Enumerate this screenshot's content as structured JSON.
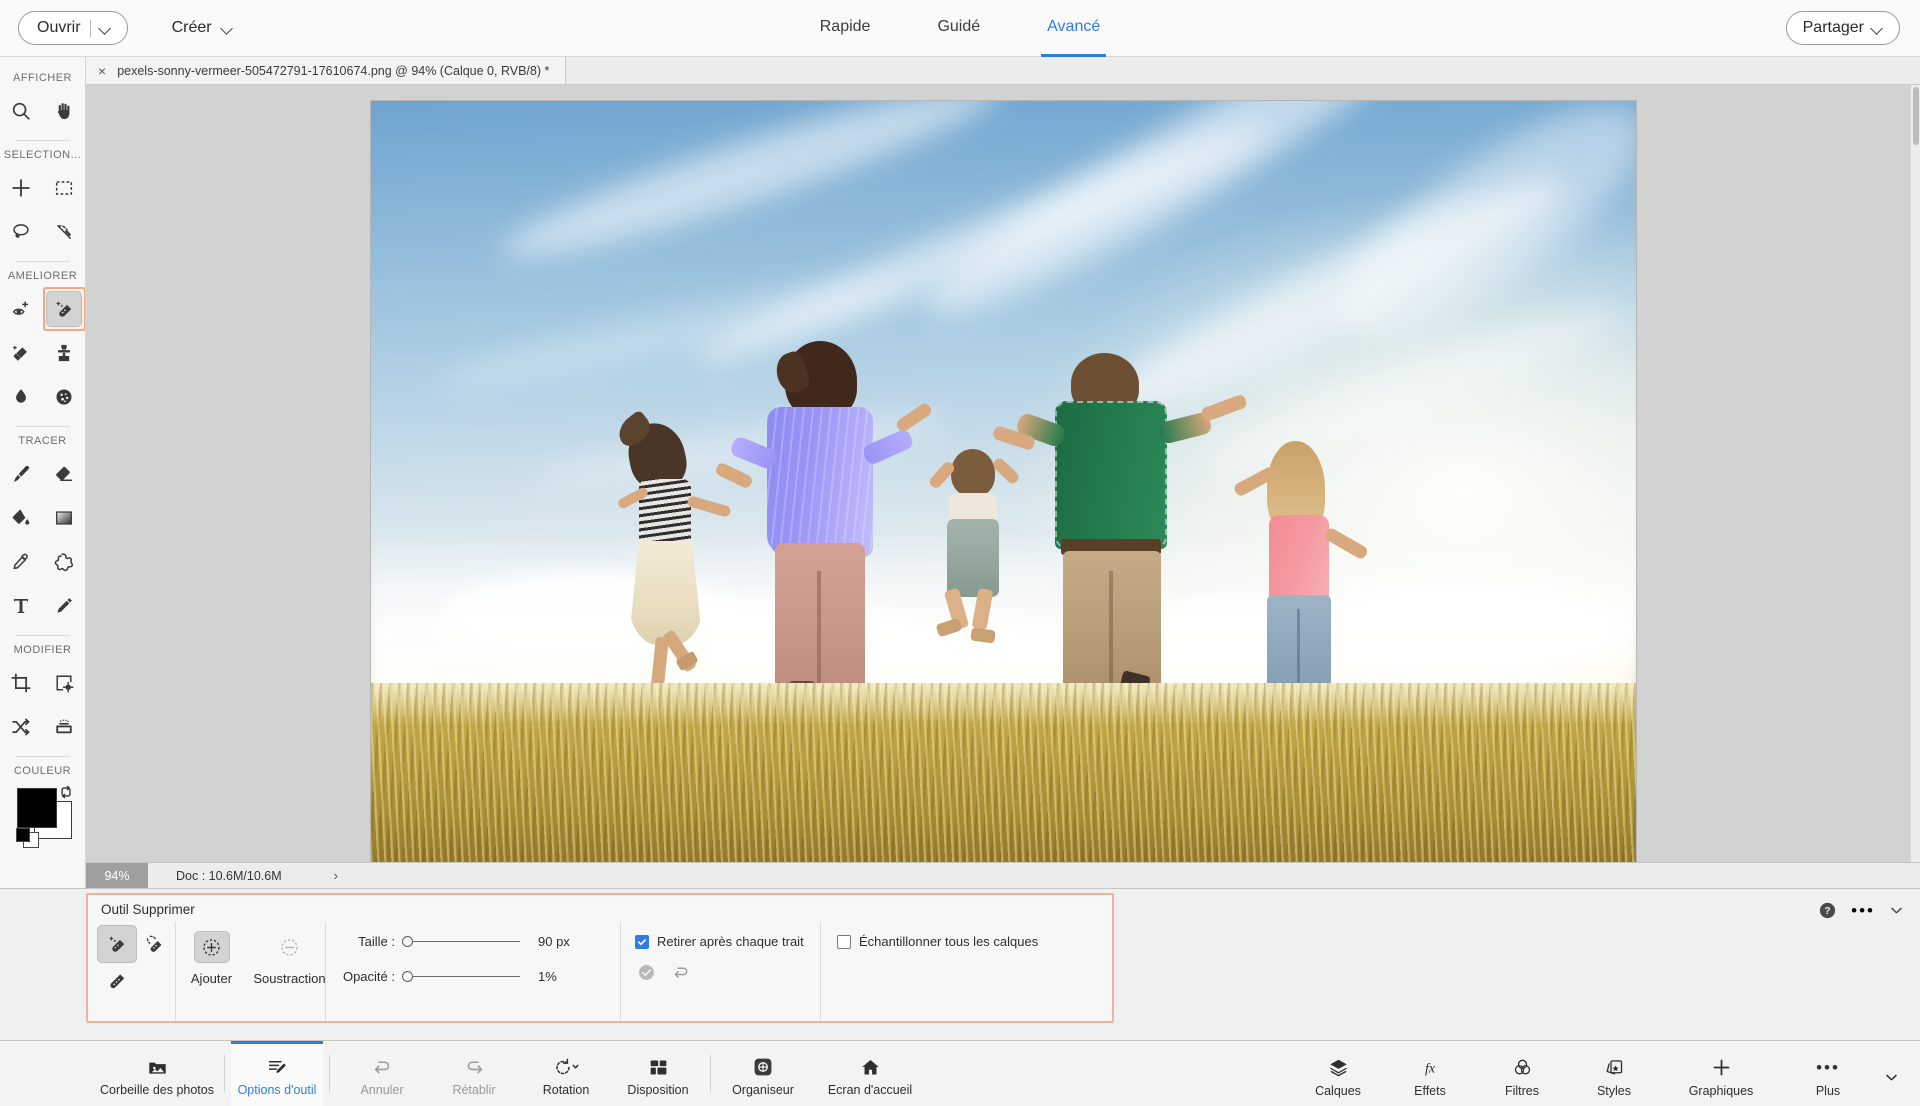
{
  "topbar": {
    "open_label": "Ouvrir",
    "create_label": "Créer",
    "share_label": "Partager",
    "modes": [
      {
        "label": "Rapide",
        "active": false
      },
      {
        "label": "Guidé",
        "active": false
      },
      {
        "label": "Avancé",
        "active": true
      }
    ],
    "accent_color": "#2f7de1"
  },
  "document_tab": {
    "title": "pexels-sonny-vermeer-505472791-17610674.png @ 94% (Calque 0, RVB/8) *",
    "close_glyph": "×"
  },
  "toolbar": {
    "groups": [
      {
        "label": "AFFICHER",
        "tools": [
          {
            "name": "zoom-tool",
            "selected": false
          },
          {
            "name": "hand-tool",
            "selected": false
          }
        ]
      },
      {
        "label": "SELECTION...",
        "tools": [
          {
            "name": "move-tool",
            "selected": false
          },
          {
            "name": "rectangular-marquee-tool",
            "selected": false
          },
          {
            "name": "lasso-tool",
            "selected": false
          },
          {
            "name": "magic-wand-tool",
            "selected": false
          }
        ]
      },
      {
        "label": "AMELIORER",
        "tools": [
          {
            "name": "red-eye-tool",
            "selected": false
          },
          {
            "name": "remove-tool",
            "selected": true
          },
          {
            "name": "smart-brush-tool",
            "selected": false
          },
          {
            "name": "clone-stamp-tool",
            "selected": false
          },
          {
            "name": "blur-tool",
            "selected": false
          },
          {
            "name": "sponge-tool",
            "selected": false
          }
        ]
      },
      {
        "label": "TRACER",
        "tools": [
          {
            "name": "brush-tool",
            "selected": false
          },
          {
            "name": "eraser-tool",
            "selected": false
          },
          {
            "name": "paint-bucket-tool",
            "selected": false
          },
          {
            "name": "gradient-tool",
            "selected": false
          },
          {
            "name": "eyedropper-tool",
            "selected": false
          },
          {
            "name": "custom-shape-tool",
            "selected": false
          },
          {
            "name": "type-tool",
            "selected": false
          },
          {
            "name": "pencil-tool",
            "selected": false
          }
        ]
      },
      {
        "label": "MODIFIER",
        "tools": [
          {
            "name": "crop-tool",
            "selected": false
          },
          {
            "name": "recompose-tool",
            "selected": false
          },
          {
            "name": "content-aware-move-tool",
            "selected": false
          },
          {
            "name": "straighten-tool",
            "selected": false
          }
        ]
      },
      {
        "label": "COULEUR",
        "tools": []
      }
    ],
    "color": {
      "foreground": "#000000",
      "background": "#ffffff"
    }
  },
  "canvas": {
    "image_alt": "Famille de cinq personnes courant main dans la main dans un champ doré sous un ciel bleu"
  },
  "statusbar": {
    "zoom": "94%",
    "doc_info": "Doc : 10.6M/10.6M",
    "arrow_glyph": "›"
  },
  "tool_options": {
    "title": "Outil Supprimer",
    "highlight_color": "#f0b393",
    "brushes": [
      {
        "name": "remove-brush",
        "active": true
      },
      {
        "name": "remove-brush-soft",
        "active": false
      },
      {
        "name": "remove-brush-plain",
        "active": false
      }
    ],
    "mode_buttons": [
      {
        "label": "Ajouter",
        "name": "add-mode-button",
        "active": true
      },
      {
        "label": "Soustraction",
        "name": "subtract-mode-button",
        "active": false
      }
    ],
    "sliders": [
      {
        "label": "Taille :",
        "value": "90 px",
        "percent": 0
      },
      {
        "label": "Opacité :",
        "value": "1%",
        "percent": 0
      }
    ],
    "checkboxes": [
      {
        "label": "Retirer après chaque trait",
        "checked": true
      },
      {
        "label": "Échantillonner tous les calques",
        "checked": false
      }
    ],
    "actions": [
      {
        "name": "commit-icon"
      },
      {
        "name": "undo-stroke-icon"
      }
    ],
    "corner": [
      {
        "name": "help-icon"
      },
      {
        "name": "more-options-icon"
      },
      {
        "name": "collapse-panel-icon"
      }
    ]
  },
  "taskbar": {
    "left": [
      {
        "label": "Corbeille des photos",
        "name": "photo-bin-button",
        "active": false,
        "dim": false
      },
      {
        "label": "Options d'outil",
        "name": "tool-options-button",
        "active": true,
        "dim": false
      },
      {
        "label": "Annuler",
        "name": "undo-button",
        "active": false,
        "dim": true
      },
      {
        "label": "Rétablir",
        "name": "redo-button",
        "active": false,
        "dim": true
      },
      {
        "label": "Rotation",
        "name": "rotate-button",
        "active": false,
        "dim": false
      },
      {
        "label": "Disposition",
        "name": "layout-button",
        "active": false,
        "dim": false
      },
      {
        "label": "Organiseur",
        "name": "organizer-button",
        "active": false,
        "dim": false
      },
      {
        "label": "Ecran d'accueil",
        "name": "home-screen-button",
        "active": false,
        "dim": false
      }
    ],
    "right": [
      {
        "label": "Calques",
        "name": "layers-button"
      },
      {
        "label": "Effets",
        "name": "effects-button"
      },
      {
        "label": "Filtres",
        "name": "filters-button"
      },
      {
        "label": "Styles",
        "name": "styles-button"
      },
      {
        "label": "Graphiques",
        "name": "graphics-button"
      },
      {
        "label": "Plus",
        "name": "more-button"
      }
    ]
  }
}
